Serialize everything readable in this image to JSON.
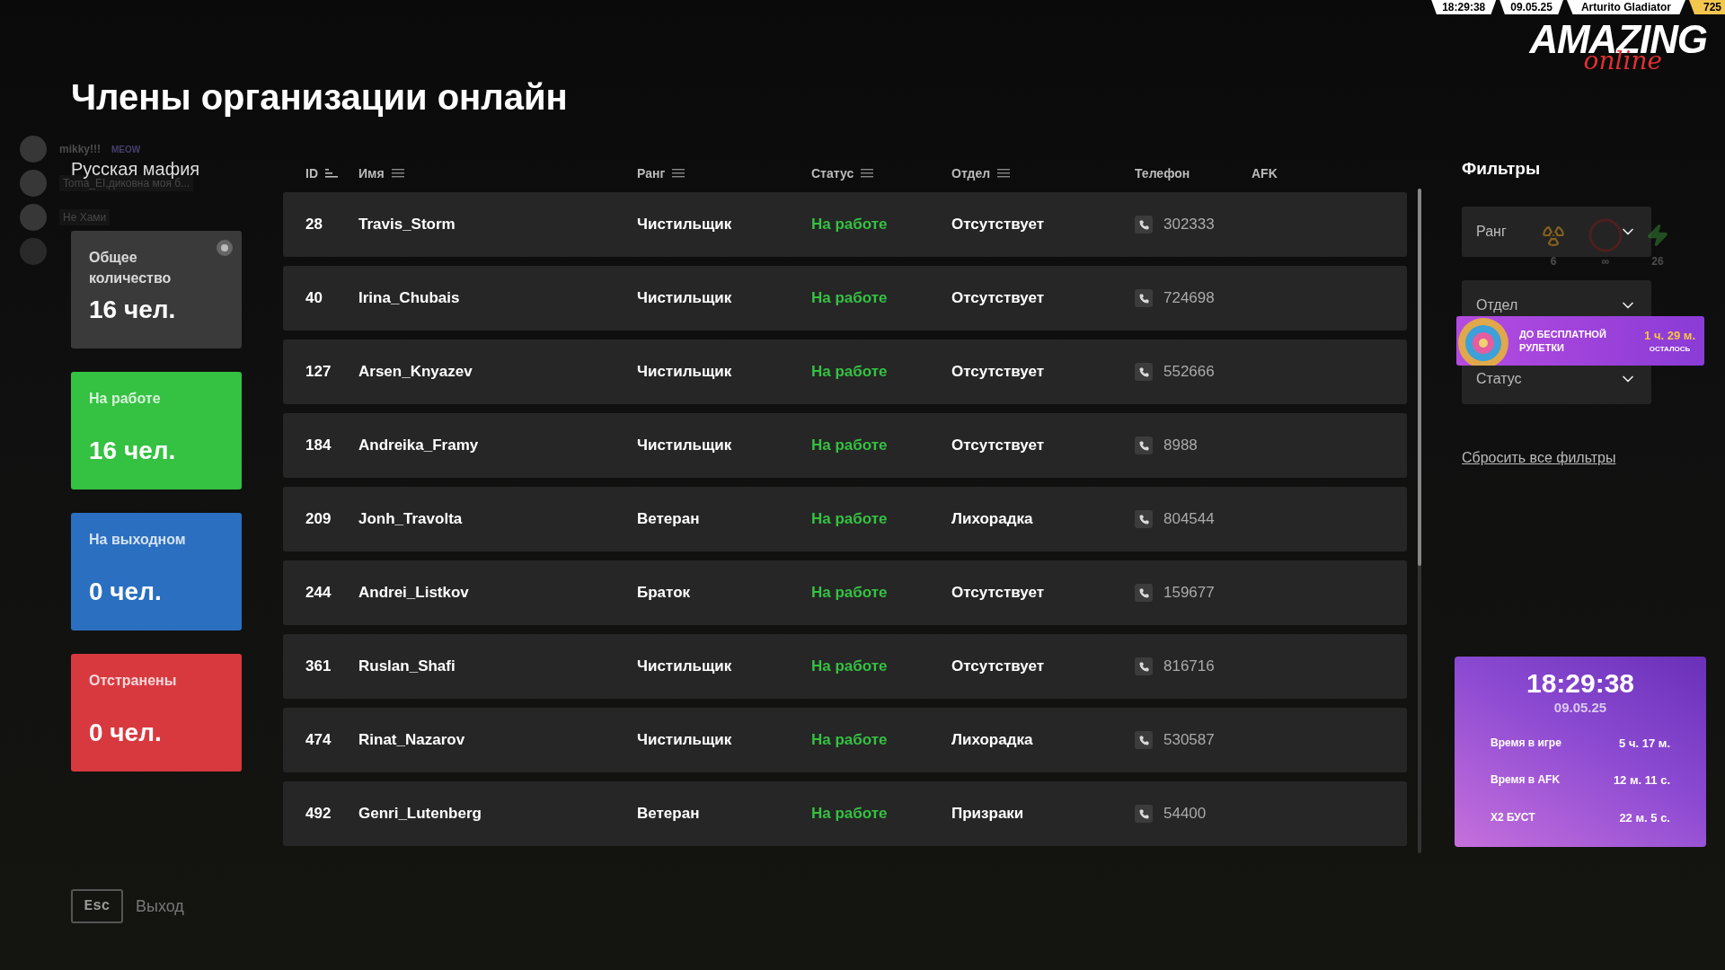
{
  "top_bar": {
    "time": "18:29:38",
    "date": "09.05.25",
    "player": "Arturito Gladiator",
    "id": "725"
  },
  "logo": {
    "word": "AMAZING",
    "sub": "online"
  },
  "title": "Члены организации онлайн",
  "chat": [
    {
      "name": "mikky!!!",
      "tag": "MEOW"
    },
    {
      "text": "Toma_EI,диковна моя б..."
    },
    {
      "text": "Не Хами"
    }
  ],
  "organization": "Русская мафия",
  "stats": [
    {
      "label": "Общее количество",
      "value": "16 чел.",
      "color": "#3a3a3a"
    },
    {
      "label": "На работе",
      "value": "16 чел.",
      "color": "#35c142"
    },
    {
      "label": "На выходном",
      "value": "0 чел.",
      "color": "#2a6fc0"
    },
    {
      "label": "Отстранены",
      "value": "0 чел.",
      "color": "#d8393f"
    }
  ],
  "table": {
    "columns": [
      {
        "label": "ID",
        "kind": "sort"
      },
      {
        "label": "Имя",
        "kind": "filter"
      },
      {
        "label": "Ранг",
        "kind": "filter"
      },
      {
        "label": "Статус",
        "kind": "filter"
      },
      {
        "label": "Отдел",
        "kind": "filter"
      },
      {
        "label": "Телефон",
        "kind": "plain"
      },
      {
        "label": "AFK",
        "kind": "plain"
      }
    ],
    "rows": [
      {
        "id": "28",
        "name": "Travis_Storm",
        "rank": "Чистильщик",
        "status": "На работе",
        "department": "Отсутствует",
        "phone": "302333"
      },
      {
        "id": "40",
        "name": "Irina_Chubais",
        "rank": "Чистильщик",
        "status": "На работе",
        "department": "Отсутствует",
        "phone": "724698"
      },
      {
        "id": "127",
        "name": "Arsen_Knyazev",
        "rank": "Чистильщик",
        "status": "На работе",
        "department": "Отсутствует",
        "phone": "552666"
      },
      {
        "id": "184",
        "name": "Andreika_Framy",
        "rank": "Чистильщик",
        "status": "На работе",
        "department": "Отсутствует",
        "phone": "8988"
      },
      {
        "id": "209",
        "name": "Jonh_Travolta",
        "rank": "Ветеран",
        "status": "На работе",
        "department": "Лихорадка",
        "phone": "804544"
      },
      {
        "id": "244",
        "name": "Andrei_Listkov",
        "rank": "Браток",
        "status": "На работе",
        "department": "Отсутствует",
        "phone": "159677"
      },
      {
        "id": "361",
        "name": "Ruslan_Shafi",
        "rank": "Чистильщик",
        "status": "На работе",
        "department": "Отсутствует",
        "phone": "816716"
      },
      {
        "id": "474",
        "name": "Rinat_Nazarov",
        "rank": "Чистильщик",
        "status": "На работе",
        "department": "Лихорадка",
        "phone": "530587"
      },
      {
        "id": "492",
        "name": "Genri_Lutenberg",
        "rank": "Ветеран",
        "status": "На работе",
        "department": "Призраки",
        "phone": "54400"
      }
    ]
  },
  "filters": {
    "title": "Фильтры",
    "dropdowns": [
      "Ранг",
      "Отдел",
      "Статус"
    ],
    "reset": "Сбросить все фильтры"
  },
  "hud": [
    {
      "kind": "radiation",
      "value": "6"
    },
    {
      "kind": "pk",
      "value": "∞"
    },
    {
      "kind": "energy",
      "value": "26"
    }
  ],
  "banner": {
    "line1": "ДО БЕСПЛАТНОЙ",
    "line2": "РУЛЕТКИ",
    "time": "1 ч. 29 м.",
    "note": "ОСТАЛОСЬ"
  },
  "clock": {
    "time": "18:29:38",
    "date": "09.05.25",
    "rows": [
      {
        "label": "Время в игре",
        "value": "5 ч. 17 м."
      },
      {
        "label": "Время в AFK",
        "value": "12 м. 11 с."
      },
      {
        "label": "X2 БУСТ",
        "value": "22 м. 5 с."
      }
    ]
  },
  "exit": {
    "key": "Esc",
    "label": "Выход"
  }
}
